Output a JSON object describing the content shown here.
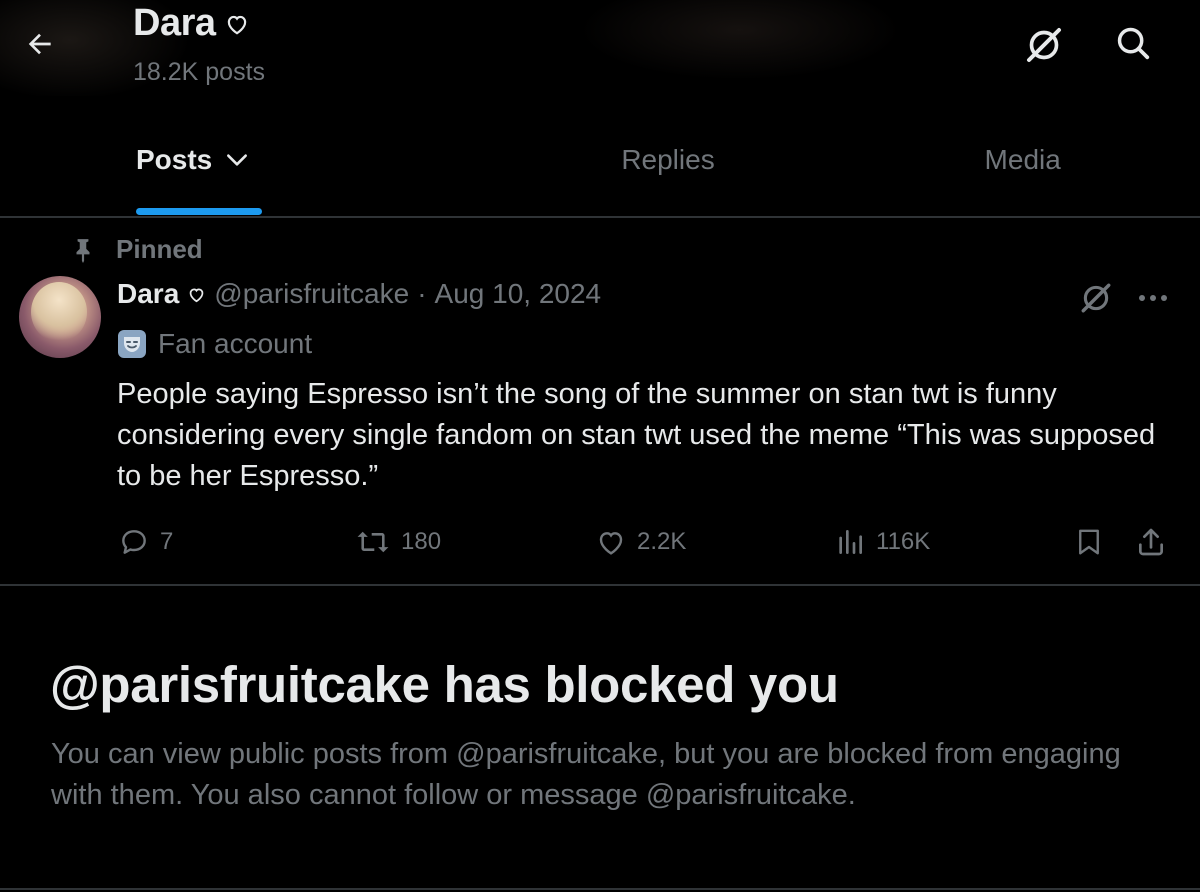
{
  "header": {
    "name": "Dara",
    "posts_count": "18.2K posts"
  },
  "tabs": [
    {
      "label": "Posts",
      "active": true
    },
    {
      "label": "Replies",
      "active": false
    },
    {
      "label": "Media",
      "active": false
    }
  ],
  "pinned_post": {
    "pinned_label": "Pinned",
    "author_name": "Dara",
    "handle": "@parisfruitcake",
    "separator": "·",
    "date": "Aug 10, 2024",
    "account_label": "Fan account",
    "text": "People saying Espresso isn’t the song of the summer on stan twt is funny considering every single fandom on stan twt used the meme “This was supposed to be her Espresso.”",
    "stats": {
      "replies": "7",
      "reposts": "180",
      "likes": "2.2K",
      "views": "116K"
    }
  },
  "blocked": {
    "title": "@parisfruitcake has blocked you",
    "description": "You can view public posts from @parisfruitcake, but you are blocked from engaging with them. You also cannot follow or message @parisfruitcake."
  },
  "icons": {
    "back": "arrow-left-icon",
    "grok": "grok-icon",
    "search": "search-icon",
    "more": "more-icon",
    "pin": "pin-icon",
    "reply": "reply-icon",
    "repost": "repost-icon",
    "like": "heart-icon",
    "views": "views-icon",
    "bookmark": "bookmark-icon",
    "share": "share-icon"
  },
  "colors": {
    "background": "#000000",
    "primary_text": "#e7e9ea",
    "secondary_text": "#71767b",
    "accent": "#1d9bf0",
    "divider": "#2f3336"
  }
}
